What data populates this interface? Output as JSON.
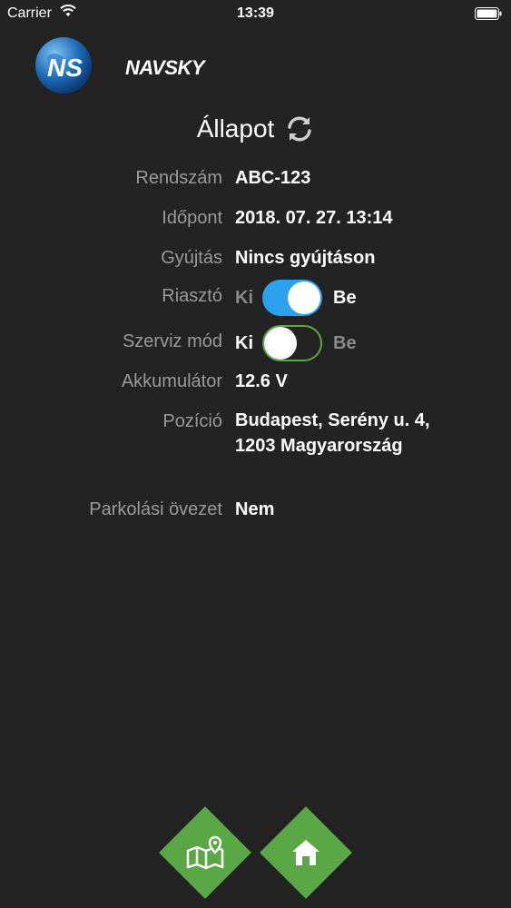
{
  "status_bar": {
    "carrier": "Carrier",
    "time": "13:39"
  },
  "logo": {
    "text": "NAVSKY",
    "monogram": "NS"
  },
  "header": {
    "title": "Állapot",
    "refresh_icon": "refresh-icon"
  },
  "fields": {
    "rendszam": {
      "label": "Rendszám",
      "value": "ABC-123"
    },
    "idopont": {
      "label": "Időpont",
      "value": "2018. 07. 27. 13:14"
    },
    "gyujtas": {
      "label": "Gyújtás",
      "value": "Nincs gyújtáson"
    },
    "riaszto": {
      "label": "Riasztó",
      "off_label": "Ki",
      "on_label": "Be",
      "state": "on"
    },
    "szerviz": {
      "label": "Szerviz mód",
      "off_label": "Ki",
      "on_label": "Be",
      "state": "off"
    },
    "akkumulator": {
      "label": "Akkumulátor",
      "value": "12.6 V"
    },
    "pozicio": {
      "label": "Pozíció",
      "value": "Budapest, Serény u. 4, 1203 Magyarország"
    },
    "parkolasi": {
      "label": "Parkolási övezet",
      "value": "Nem"
    }
  },
  "bottom_nav": {
    "map_icon": "map-icon",
    "home_icon": "home-icon"
  },
  "colors": {
    "background": "#232323",
    "accent_green": "#5aa845",
    "toggle_blue": "#2aa2ee",
    "label_gray": "#9a9a9a"
  }
}
